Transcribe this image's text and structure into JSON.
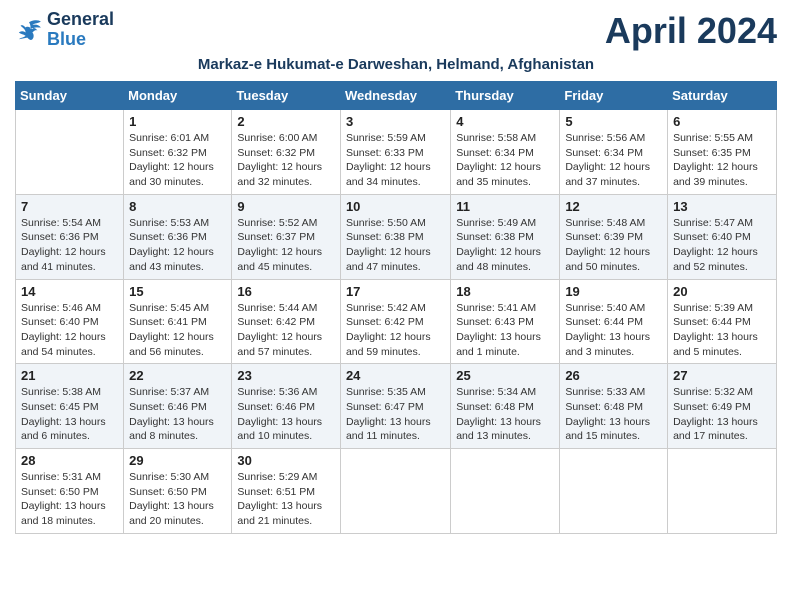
{
  "header": {
    "logo_line1": "General",
    "logo_line2": "Blue",
    "title": "April 2024",
    "subtitle": "Markaz-e Hukumat-e Darweshan, Helmand, Afghanistan"
  },
  "days_of_week": [
    "Sunday",
    "Monday",
    "Tuesday",
    "Wednesday",
    "Thursday",
    "Friday",
    "Saturday"
  ],
  "weeks": [
    [
      {
        "day": "",
        "info": ""
      },
      {
        "day": "1",
        "info": "Sunrise: 6:01 AM\nSunset: 6:32 PM\nDaylight: 12 hours\nand 30 minutes."
      },
      {
        "day": "2",
        "info": "Sunrise: 6:00 AM\nSunset: 6:32 PM\nDaylight: 12 hours\nand 32 minutes."
      },
      {
        "day": "3",
        "info": "Sunrise: 5:59 AM\nSunset: 6:33 PM\nDaylight: 12 hours\nand 34 minutes."
      },
      {
        "day": "4",
        "info": "Sunrise: 5:58 AM\nSunset: 6:34 PM\nDaylight: 12 hours\nand 35 minutes."
      },
      {
        "day": "5",
        "info": "Sunrise: 5:56 AM\nSunset: 6:34 PM\nDaylight: 12 hours\nand 37 minutes."
      },
      {
        "day": "6",
        "info": "Sunrise: 5:55 AM\nSunset: 6:35 PM\nDaylight: 12 hours\nand 39 minutes."
      }
    ],
    [
      {
        "day": "7",
        "info": "Sunrise: 5:54 AM\nSunset: 6:36 PM\nDaylight: 12 hours\nand 41 minutes."
      },
      {
        "day": "8",
        "info": "Sunrise: 5:53 AM\nSunset: 6:36 PM\nDaylight: 12 hours\nand 43 minutes."
      },
      {
        "day": "9",
        "info": "Sunrise: 5:52 AM\nSunset: 6:37 PM\nDaylight: 12 hours\nand 45 minutes."
      },
      {
        "day": "10",
        "info": "Sunrise: 5:50 AM\nSunset: 6:38 PM\nDaylight: 12 hours\nand 47 minutes."
      },
      {
        "day": "11",
        "info": "Sunrise: 5:49 AM\nSunset: 6:38 PM\nDaylight: 12 hours\nand 48 minutes."
      },
      {
        "day": "12",
        "info": "Sunrise: 5:48 AM\nSunset: 6:39 PM\nDaylight: 12 hours\nand 50 minutes."
      },
      {
        "day": "13",
        "info": "Sunrise: 5:47 AM\nSunset: 6:40 PM\nDaylight: 12 hours\nand 52 minutes."
      }
    ],
    [
      {
        "day": "14",
        "info": "Sunrise: 5:46 AM\nSunset: 6:40 PM\nDaylight: 12 hours\nand 54 minutes."
      },
      {
        "day": "15",
        "info": "Sunrise: 5:45 AM\nSunset: 6:41 PM\nDaylight: 12 hours\nand 56 minutes."
      },
      {
        "day": "16",
        "info": "Sunrise: 5:44 AM\nSunset: 6:42 PM\nDaylight: 12 hours\nand 57 minutes."
      },
      {
        "day": "17",
        "info": "Sunrise: 5:42 AM\nSunset: 6:42 PM\nDaylight: 12 hours\nand 59 minutes."
      },
      {
        "day": "18",
        "info": "Sunrise: 5:41 AM\nSunset: 6:43 PM\nDaylight: 13 hours\nand 1 minute."
      },
      {
        "day": "19",
        "info": "Sunrise: 5:40 AM\nSunset: 6:44 PM\nDaylight: 13 hours\nand 3 minutes."
      },
      {
        "day": "20",
        "info": "Sunrise: 5:39 AM\nSunset: 6:44 PM\nDaylight: 13 hours\nand 5 minutes."
      }
    ],
    [
      {
        "day": "21",
        "info": "Sunrise: 5:38 AM\nSunset: 6:45 PM\nDaylight: 13 hours\nand 6 minutes."
      },
      {
        "day": "22",
        "info": "Sunrise: 5:37 AM\nSunset: 6:46 PM\nDaylight: 13 hours\nand 8 minutes."
      },
      {
        "day": "23",
        "info": "Sunrise: 5:36 AM\nSunset: 6:46 PM\nDaylight: 13 hours\nand 10 minutes."
      },
      {
        "day": "24",
        "info": "Sunrise: 5:35 AM\nSunset: 6:47 PM\nDaylight: 13 hours\nand 11 minutes."
      },
      {
        "day": "25",
        "info": "Sunrise: 5:34 AM\nSunset: 6:48 PM\nDaylight: 13 hours\nand 13 minutes."
      },
      {
        "day": "26",
        "info": "Sunrise: 5:33 AM\nSunset: 6:48 PM\nDaylight: 13 hours\nand 15 minutes."
      },
      {
        "day": "27",
        "info": "Sunrise: 5:32 AM\nSunset: 6:49 PM\nDaylight: 13 hours\nand 17 minutes."
      }
    ],
    [
      {
        "day": "28",
        "info": "Sunrise: 5:31 AM\nSunset: 6:50 PM\nDaylight: 13 hours\nand 18 minutes."
      },
      {
        "day": "29",
        "info": "Sunrise: 5:30 AM\nSunset: 6:50 PM\nDaylight: 13 hours\nand 20 minutes."
      },
      {
        "day": "30",
        "info": "Sunrise: 5:29 AM\nSunset: 6:51 PM\nDaylight: 13 hours\nand 21 minutes."
      },
      {
        "day": "",
        "info": ""
      },
      {
        "day": "",
        "info": ""
      },
      {
        "day": "",
        "info": ""
      },
      {
        "day": "",
        "info": ""
      }
    ]
  ]
}
